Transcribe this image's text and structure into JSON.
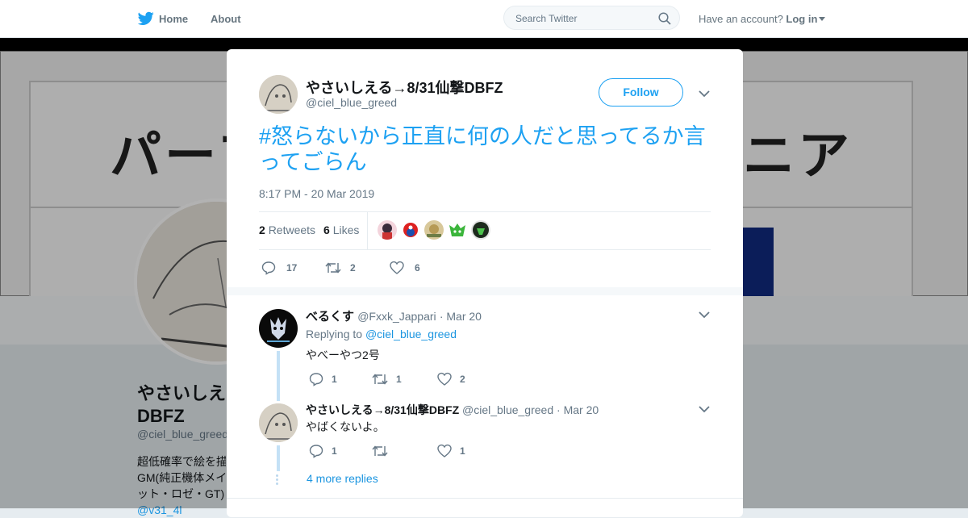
{
  "nav": {
    "home": "Home",
    "about": "About",
    "search_placeholder": "Search Twitter",
    "have_account": "Have an account?",
    "login": "Log in"
  },
  "background": {
    "header_text_left": "パーフ",
    "header_text_right": "ニア",
    "name_line1": "やさいしえる",
    "name_line2": "DBFZ",
    "handle": "@ciel_blue_greed",
    "bio_line1": "超低確率で絵を描",
    "bio_line2": "GM(純正機体メイ",
    "bio_line3": "ット・ロゼ・GT)",
    "bio_link": "@v31_4l"
  },
  "tweet": {
    "name": "やさいしえる→8/31仙撃DBFZ",
    "handle": "@ciel_blue_greed",
    "follow": "Follow",
    "text": "#怒らないから正直に何の人だと思ってるか言ってごらん",
    "time": "8:17 PM - 20 Mar 2019",
    "retweets_count": "2",
    "retweets_label": "Retweets",
    "likes_count": "6",
    "likes_label": "Likes",
    "actions": {
      "reply": "17",
      "retweet": "2",
      "like": "6"
    }
  },
  "replies": [
    {
      "name": "べるくす",
      "handle": "@Fxxk_Jappari",
      "date": "· Mar 20",
      "replying_to_label": "Replying to",
      "replying_to": "@ciel_blue_greed",
      "text": "やべーやつ2号",
      "actions": {
        "reply": "1",
        "retweet": "1",
        "like": "2"
      }
    },
    {
      "name": "やさいしえる→8/31仙撃DBFZ",
      "handle": "@ciel_blue_greed",
      "date": "· Mar 20",
      "text": "やばくないよ。",
      "actions": {
        "reply": "1",
        "retweet": "",
        "like": "1"
      }
    }
  ],
  "more_replies": "4 more replies",
  "colors": {
    "accent": "#1da1f2",
    "link": "#1b95e0",
    "muted": "#657786"
  }
}
